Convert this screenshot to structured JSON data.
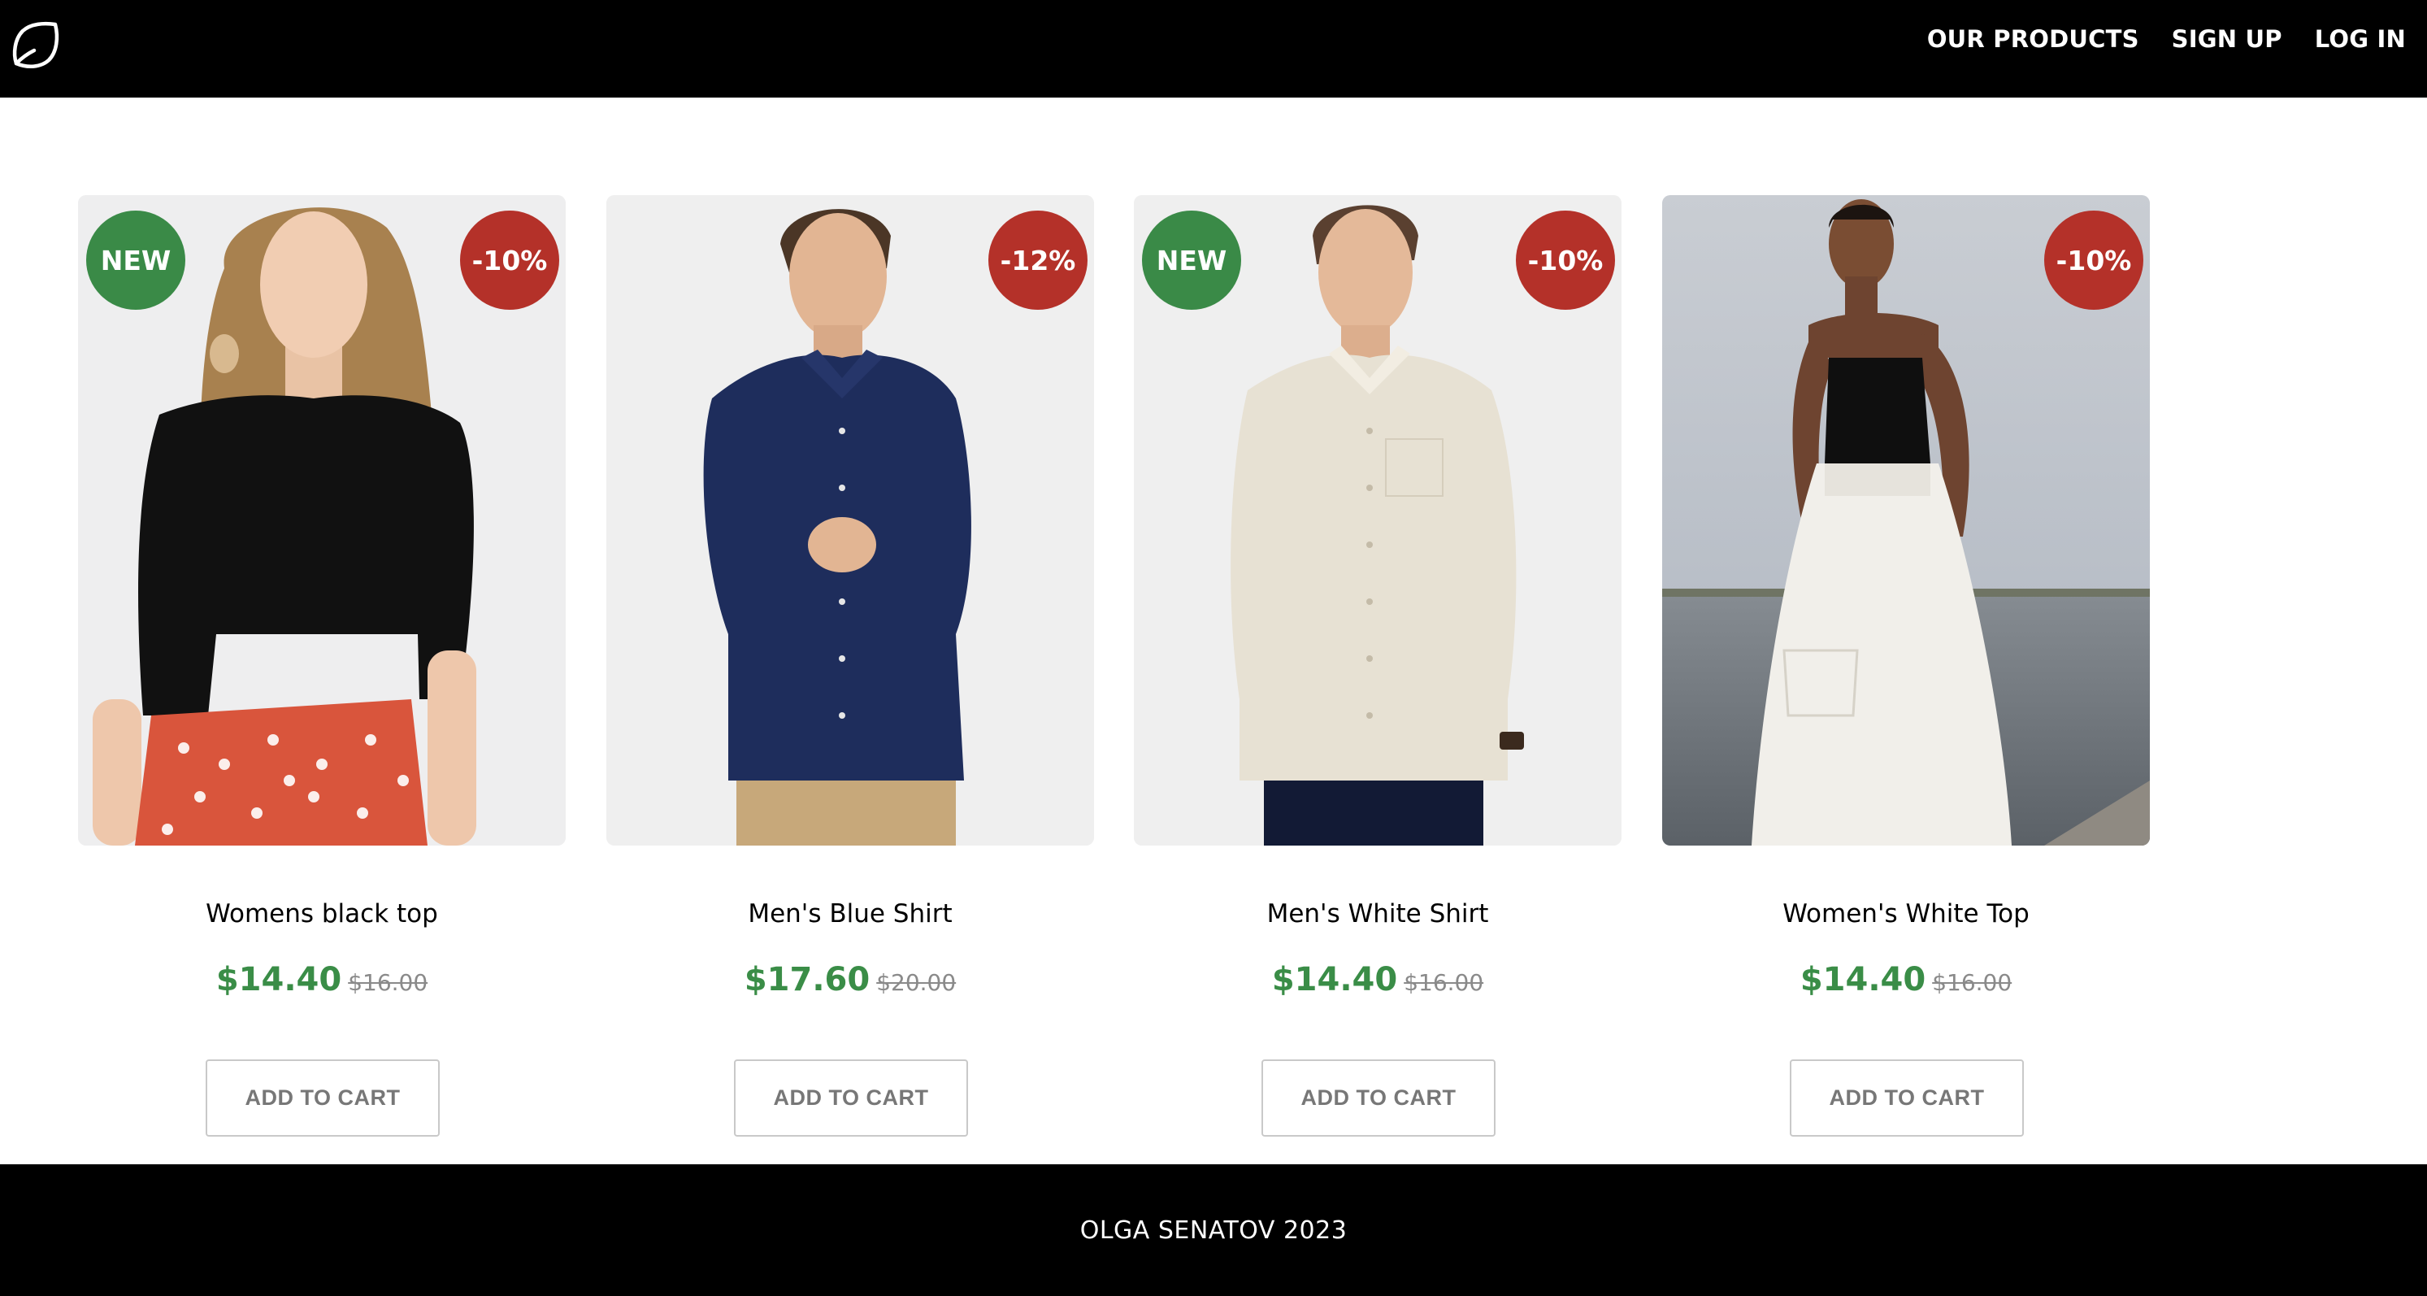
{
  "header": {
    "logo_icon": "leaf-outline-icon",
    "nav": [
      {
        "label": "OUR PRODUCTS"
      },
      {
        "label": "SIGN UP"
      },
      {
        "label": "LOG IN"
      }
    ]
  },
  "colors": {
    "header_bg": "#000000",
    "new_badge": "#3a8a47",
    "discount_badge": "#b43129",
    "price": "#3a8d47"
  },
  "products": [
    {
      "name": "Womens black top",
      "price": "$14.40",
      "old_price": "$16.00",
      "new_badge": "NEW",
      "discount": "-10%",
      "cta": "ADD TO CART"
    },
    {
      "name": "Men's Blue Shirt",
      "price": "$17.60",
      "old_price": "$20.00",
      "discount": "-12%",
      "cta": "ADD TO CART"
    },
    {
      "name": "Men's White Shirt",
      "price": "$14.40",
      "old_price": "$16.00",
      "new_badge": "NEW",
      "discount": "-10%",
      "cta": "ADD TO CART"
    },
    {
      "name": "Women's White Top",
      "price": "$14.40",
      "old_price": "$16.00",
      "discount": "-10%",
      "cta": "ADD TO CART"
    }
  ],
  "footer": {
    "text": "OLGA SENATOV 2023"
  }
}
